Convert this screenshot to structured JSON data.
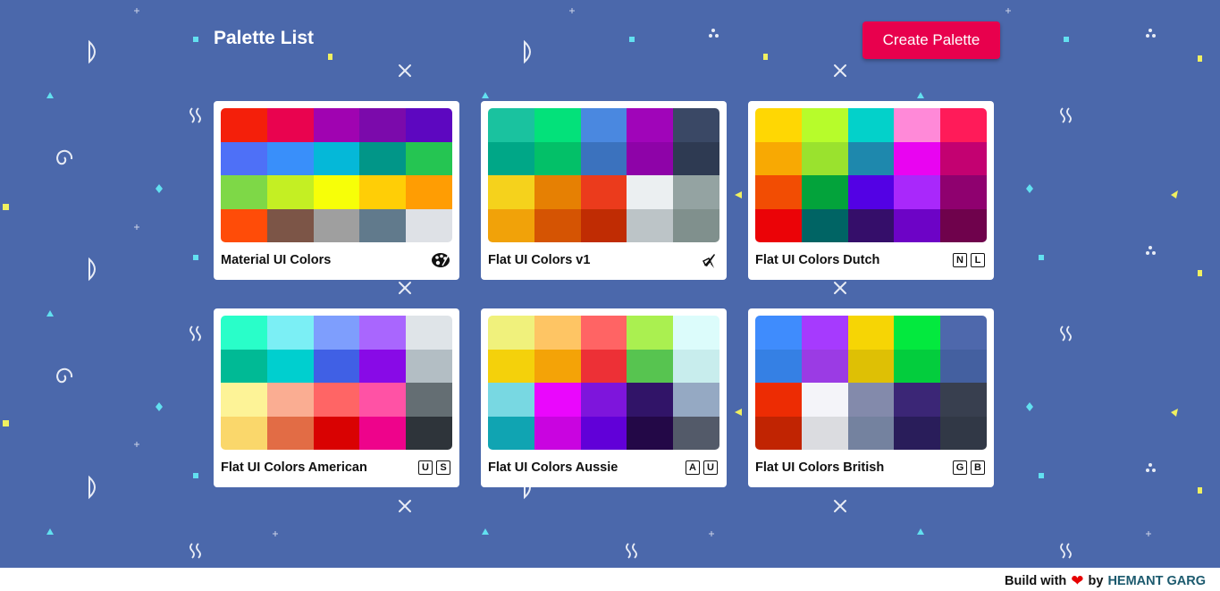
{
  "header": {
    "title": "Palette List",
    "create_button_label": "Create Palette"
  },
  "palettes": [
    {
      "name": "Material UI Colors",
      "emoji": "palette-icon",
      "colors": [
        "#f41f0a",
        "#e9034f",
        "#a003b1",
        "#7b0aab",
        "#5d07c0",
        "#4e70f7",
        "#398ffa",
        "#05b8d8",
        "#019688",
        "#25c552",
        "#7ed847",
        "#c4ef23",
        "#f7ff08",
        "#ffce06",
        "#ff9d03",
        "#ff4c08",
        "#7c5547",
        "#9f9f9f",
        "#617a8c",
        "#dee1e6"
      ]
    },
    {
      "name": "Flat UI Colors v1",
      "emoji": "rocket-icon",
      "colors": [
        "#1ac29f",
        "#03e17a",
        "#4a88e0",
        "#a005b9",
        "#3a4865",
        "#00a787",
        "#03c068",
        "#3b72be",
        "#8e03a8",
        "#2e3a52",
        "#f5d21c",
        "#e68003",
        "#eb3b1c",
        "#ebeff1",
        "#94a3a2",
        "#f1a209",
        "#d55403",
        "#c02c03",
        "#bcc4c7",
        "#80908d"
      ]
    },
    {
      "name": "Flat UI Colors Dutch",
      "emoji": "NL",
      "colors": [
        "#ffd703",
        "#b7fc2b",
        "#03d1ca",
        "#ff89d8",
        "#ff1b59",
        "#f8a903",
        "#9ae22e",
        "#1e88ad",
        "#e904f1",
        "#c30171",
        "#f24d03",
        "#03a33b",
        "#5301e4",
        "#a928fb",
        "#8f016f",
        "#eb0307",
        "#006464",
        "#350e6a",
        "#6d03c6",
        "#6f024c"
      ]
    },
    {
      "name": "Flat UI Colors American",
      "emoji": "US",
      "colors": [
        "#29fec9",
        "#7beff5",
        "#7e9efd",
        "#a966fe",
        "#dfe4e8",
        "#00ba95",
        "#00cfcf",
        "#4060e5",
        "#880ae7",
        "#b3bec4",
        "#fdf397",
        "#faad92",
        "#ff6565",
        "#ff52a5",
        "#646e73",
        "#fad76b",
        "#e26c45",
        "#d90202",
        "#ee038b",
        "#2e343a"
      ]
    },
    {
      "name": "Flat UI Colors Aussie",
      "emoji": "AU",
      "colors": [
        "#f0f17c",
        "#fec564",
        "#ff6464",
        "#aaf050",
        "#dcfcfb",
        "#f4d10b",
        "#f4a307",
        "#ed3036",
        "#57c450",
        "#c8eded",
        "#78d8e2",
        "#ea07fd",
        "#7e15dc",
        "#311468",
        "#95a9c3",
        "#10a4b2",
        "#c904e0",
        "#6100d8",
        "#230847",
        "#535a69"
      ]
    },
    {
      "name": "Flat UI Colors British",
      "emoji": "GB",
      "colors": [
        "#3f8cfd",
        "#a63afe",
        "#f6d505",
        "#03e93e",
        "#4e68ac",
        "#3580e4",
        "#9b3be4",
        "#dec005",
        "#03cd3d",
        "#4460a0",
        "#ed2c03",
        "#f4f4f9",
        "#838aab",
        "#3b2676",
        "#383f4f",
        "#c12402",
        "#dbdce0",
        "#74829f",
        "#291d5a",
        "#313846"
      ]
    }
  ],
  "footer": {
    "prefix": "Build with",
    "heart": "❤",
    "by": "by",
    "author": "HEMANT GARG"
  },
  "colors": {
    "background": "#4b68ab",
    "accent": "#e8004d",
    "heart": "#e60000"
  }
}
